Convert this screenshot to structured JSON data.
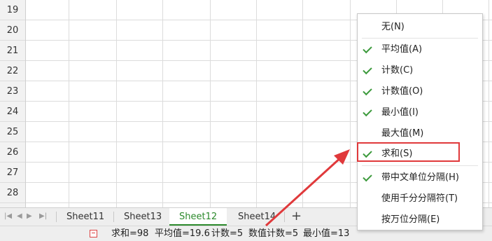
{
  "rows": [
    "19",
    "20",
    "21",
    "22",
    "23",
    "24",
    "25",
    "26",
    "27",
    "28"
  ],
  "sheet_nav": [
    "|◀",
    "◀",
    "▶",
    "▶|"
  ],
  "sheets": [
    {
      "label": "Sheet11",
      "active": false
    },
    {
      "label": "Sheet13",
      "active": false
    },
    {
      "label": "Sheet12",
      "active": true
    },
    {
      "label": "Sheet14",
      "active": false
    }
  ],
  "add_sheet": "+",
  "status": {
    "sum": "求和=98",
    "avg": "平均值=19.6",
    "count": "计数=5",
    "num_count": "数值计数=5",
    "min": "最小值=13"
  },
  "menu": {
    "none": "无(N)",
    "avg": "平均值(A)",
    "count": "计数(C)",
    "num_count": "计数值(O)",
    "min": "最小值(I)",
    "max": "最大值(M)",
    "sum": "求和(S)",
    "cn_units": "带中文单位分隔(H)",
    "thousands": "使用千分分隔符(T)",
    "wan": "按万位分隔(E)"
  },
  "colors": {
    "accent_green": "#2d8a2d",
    "highlight_red": "#e0393b"
  }
}
